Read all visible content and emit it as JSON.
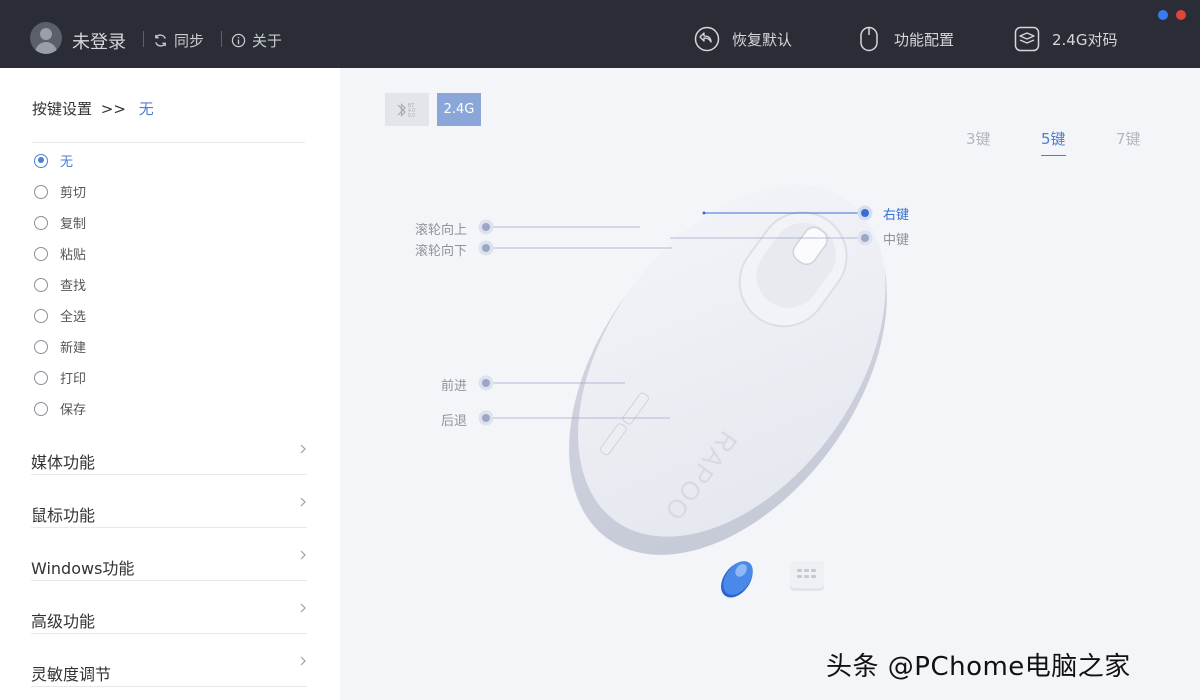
{
  "topbar": {
    "login_label": "未登录",
    "sync_label": "同步",
    "about_label": "关于",
    "actions": [
      {
        "label": "恢复默认",
        "icon": "undo-circle-icon"
      },
      {
        "label": "功能配置",
        "icon": "mouse-outline-icon"
      },
      {
        "label": "2.4G对码",
        "icon": "layers-icon"
      }
    ],
    "window_dot_colors": [
      "#3b7bf0",
      "#e0453a"
    ]
  },
  "sidebar": {
    "header_label": "按键设置",
    "header_arrow": ">>",
    "header_value": "无",
    "options": [
      {
        "label": "无",
        "checked": true
      },
      {
        "label": "剪切",
        "checked": false
      },
      {
        "label": "复制",
        "checked": false
      },
      {
        "label": "粘贴",
        "checked": false
      },
      {
        "label": "查找",
        "checked": false
      },
      {
        "label": "全选",
        "checked": false
      },
      {
        "label": "新建",
        "checked": false
      },
      {
        "label": "打印",
        "checked": false
      },
      {
        "label": "保存",
        "checked": false
      }
    ],
    "categories": [
      {
        "label": "媒体功能"
      },
      {
        "label": "鼠标功能"
      },
      {
        "label": "Windows功能"
      },
      {
        "label": "高级功能"
      },
      {
        "label": "灵敏度调节"
      }
    ]
  },
  "main": {
    "modes": [
      {
        "label": "BT 4.0 5.0",
        "icon": "bluetooth-icon",
        "active": false
      },
      {
        "label": "2.4G",
        "active": true
      }
    ],
    "key_tabs": [
      {
        "label": "3键",
        "active": false
      },
      {
        "label": "5键",
        "active": true
      },
      {
        "label": "7键",
        "active": false
      }
    ],
    "button_labels": {
      "scroll_up": "滚轮向上",
      "scroll_down": "滚轮向下",
      "forward": "前进",
      "back": "后退",
      "right": "右键",
      "middle": "中键"
    },
    "mouse_brand": "RAPOO",
    "bottom_icons": [
      "mouse-device-icon",
      "keyboard-device-icon"
    ]
  },
  "colors": {
    "accent": "#4a7fd4",
    "topbar_bg": "#2a2d35",
    "mode_active": "#8ba7d9"
  },
  "watermark": "头条 @PChome电脑之家"
}
